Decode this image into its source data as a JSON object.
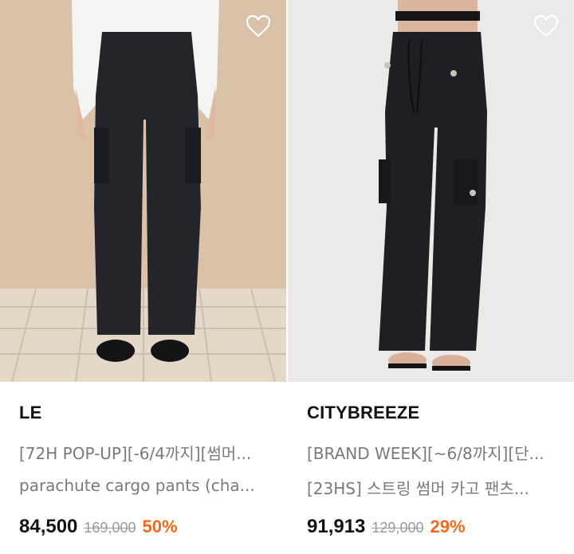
{
  "products": [
    {
      "brand": "LE",
      "tag": "[72H POP-UP][-6/4까지][썸머...",
      "name": "parachute cargo pants (cha...",
      "price": "84,500",
      "original_price": "169,000",
      "discount": "50%",
      "wishlist_icon": "heart-outline-icon"
    },
    {
      "brand": "CITYBREEZE",
      "tag": "[BRAND WEEK][~6/8까지][단...",
      "name": "[23HS] 스트링 썸머 카고 팬츠...",
      "price": "91,913",
      "original_price": "129,000",
      "discount": "29%",
      "wishlist_icon": "heart-outline-icon"
    }
  ],
  "colors": {
    "discount": "#f26a1b",
    "brand_text": "#111111",
    "muted_text": "#7a7a7a",
    "strike_text": "#999999"
  }
}
